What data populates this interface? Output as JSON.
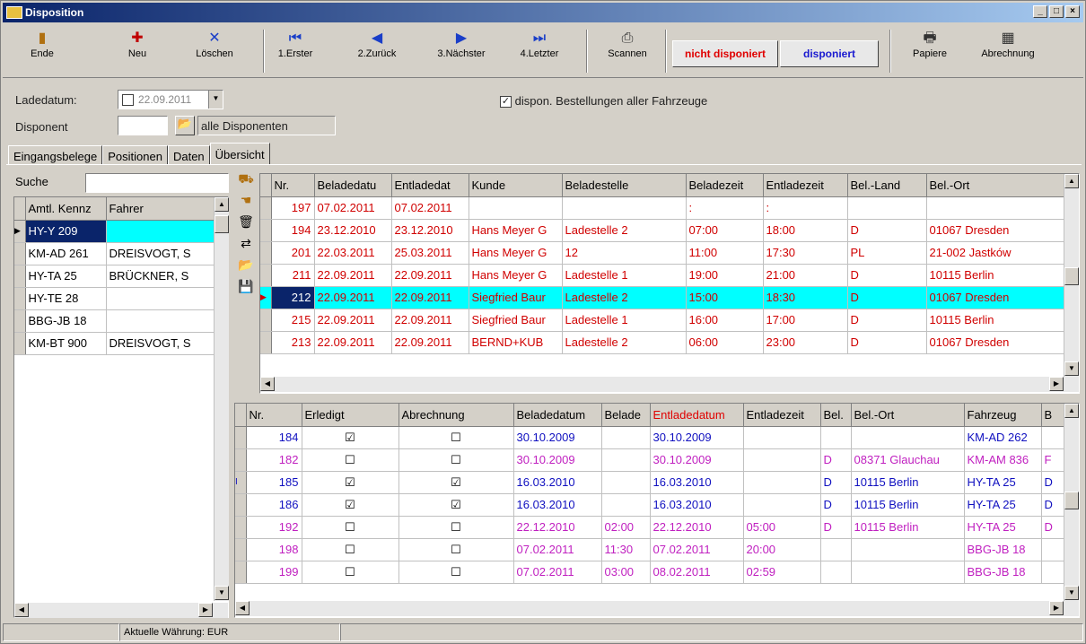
{
  "window": {
    "title": "Disposition"
  },
  "toolbar": {
    "ende": "Ende",
    "neu": "Neu",
    "loeschen": "Löschen",
    "erster": "1.Erster",
    "zurueck": "2.Zurück",
    "naechster": "3.Nächster",
    "letzter": "4.Letzter",
    "scannen": "Scannen",
    "nicht_disponiert": "nicht disponiert",
    "disponiert": "disponiert",
    "papiere": "Papiere",
    "abrechnung": "Abrechnung"
  },
  "form": {
    "ladedatum_label": "Ladedatum:",
    "ladedatum_value": "22.09.2011",
    "disponent_label": "Disponent",
    "disponent_value": "",
    "disponent_name": "alle Disponenten",
    "checkbox_label": "dispon. Bestellungen aller Fahrzeuge"
  },
  "tabs": [
    "Eingangsbelege",
    "Positionen",
    "Daten",
    "Übersicht"
  ],
  "left": {
    "search_label": "Suche",
    "search_value": "",
    "headers": [
      "Amtl. Kennz",
      "Fahrer"
    ],
    "rows": [
      [
        "HY-Y 209",
        ""
      ],
      [
        "KM-AD 261",
        "DREISVOGT, S"
      ],
      [
        "HY-TA 25",
        "BRÜCKNER, S"
      ],
      [
        "HY-TE 28",
        ""
      ],
      [
        "BBG-JB 18",
        ""
      ],
      [
        "KM-BT 900",
        "DREISVOGT, S"
      ]
    ]
  },
  "upper": {
    "headers": [
      "Nr.",
      "Beladedatu",
      "Entladedat",
      "Kunde",
      "Beladestelle",
      "Beladezeit",
      "Entladezeit",
      "Bel.-Land",
      "Bel.-Ort"
    ],
    "rows": [
      [
        "197",
        "07.02.2011",
        "07.02.2011",
        "",
        "",
        ":",
        ":",
        "",
        ""
      ],
      [
        "194",
        "23.12.2010",
        "23.12.2010",
        "Hans Meyer G",
        "Ladestelle 2",
        "07:00",
        "18:00",
        "D",
        "01067 Dresden"
      ],
      [
        "201",
        "22.03.2011",
        "25.03.2011",
        "Hans Meyer G",
        "12",
        "11:00",
        "17:30",
        "PL",
        "21-002 Jastków"
      ],
      [
        "211",
        "22.09.2011",
        "22.09.2011",
        "Hans Meyer G",
        "Ladestelle 1",
        "19:00",
        "21:00",
        "D",
        "10115 Berlin"
      ],
      [
        "212",
        "22.09.2011",
        "22.09.2011",
        "Siegfried Baur",
        "Ladestelle 2",
        "15:00",
        "18:30",
        "D",
        "01067 Dresden"
      ],
      [
        "215",
        "22.09.2011",
        "22.09.2011",
        "Siegfried Baur",
        "Ladestelle 1",
        "16:00",
        "17:00",
        "D",
        "10115 Berlin"
      ],
      [
        "213",
        "22.09.2011",
        "22.09.2011",
        "BERND+KUB",
        "Ladestelle 2",
        "06:00",
        "23:00",
        "D",
        "01067 Dresden"
      ]
    ]
  },
  "lower": {
    "headers": [
      "Nr.",
      "Erledigt",
      "Abrechnung",
      "Beladedatum",
      "Belade",
      "Entladedatum",
      "Entladezeit",
      "Bel.",
      "Bel.-Ort",
      "Fahrzeug",
      "B"
    ],
    "rows": [
      [
        "184",
        "☑",
        "☐",
        "30.10.2009",
        "",
        "30.10.2009",
        "",
        "",
        "",
        "KM-AD 262",
        ""
      ],
      [
        "182",
        "☐",
        "☐",
        "30.10.2009",
        "",
        "30.10.2009",
        "",
        "D",
        "08371 Glauchau",
        "KM-AM 836",
        "F"
      ],
      [
        "185",
        "☑",
        "☑",
        "16.03.2010",
        "",
        "16.03.2010",
        "",
        "D",
        "10115 Berlin",
        "HY-TA 25",
        "D"
      ],
      [
        "186",
        "☑",
        "☑",
        "16.03.2010",
        "",
        "16.03.2010",
        "",
        "D",
        "10115 Berlin",
        "HY-TA 25",
        "D"
      ],
      [
        "192",
        "☐",
        "☐",
        "22.12.2010",
        "02:00",
        "22.12.2010",
        "05:00",
        "D",
        "10115 Berlin",
        "HY-TA 25",
        "D"
      ],
      [
        "198",
        "☐",
        "☐",
        "07.02.2011",
        "11:30",
        "07.02.2011",
        "20:00",
        "",
        "",
        "BBG-JB 18",
        ""
      ],
      [
        "199",
        "☐",
        "☐",
        "07.02.2011",
        "03:00",
        "08.02.2011",
        "02:59",
        "",
        "",
        "BBG-JB 18",
        ""
      ]
    ],
    "row_colors": [
      "blue",
      "mag",
      "blue",
      "blue",
      "mag",
      "mag",
      "mag"
    ]
  },
  "status": {
    "currency": "Aktuelle Währung: EUR"
  }
}
